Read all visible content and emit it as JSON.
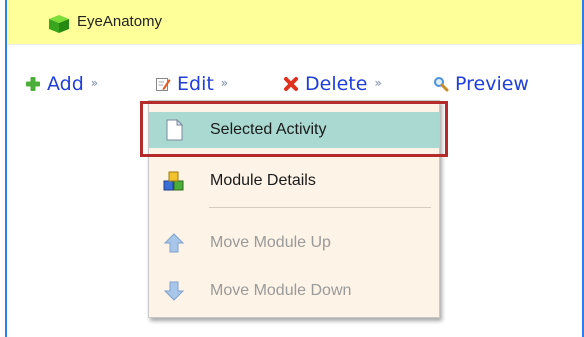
{
  "app": {
    "title": "EyeAnatomy"
  },
  "toolbar": {
    "add_label": "Add",
    "edit_label": "Edit",
    "delete_label": "Delete",
    "preview_label": "Preview"
  },
  "menu": {
    "items": [
      {
        "label": "Selected Activity",
        "icon": "page-icon",
        "state": "highlighted"
      },
      {
        "label": "Module Details",
        "icon": "module-blocks-icon",
        "state": "enabled"
      },
      {
        "label": "Move Module Up",
        "icon": "arrow-up-icon",
        "state": "disabled"
      },
      {
        "label": "Move Module Down",
        "icon": "arrow-down-icon",
        "state": "disabled"
      }
    ]
  },
  "colors": {
    "title_bar": "#ffff99",
    "link": "#1f3fd8",
    "menu_bg": "#fdf3e6",
    "highlight": "#a9d9d0",
    "annotation": "#b52a2a",
    "frame": "#2d7ff0"
  }
}
